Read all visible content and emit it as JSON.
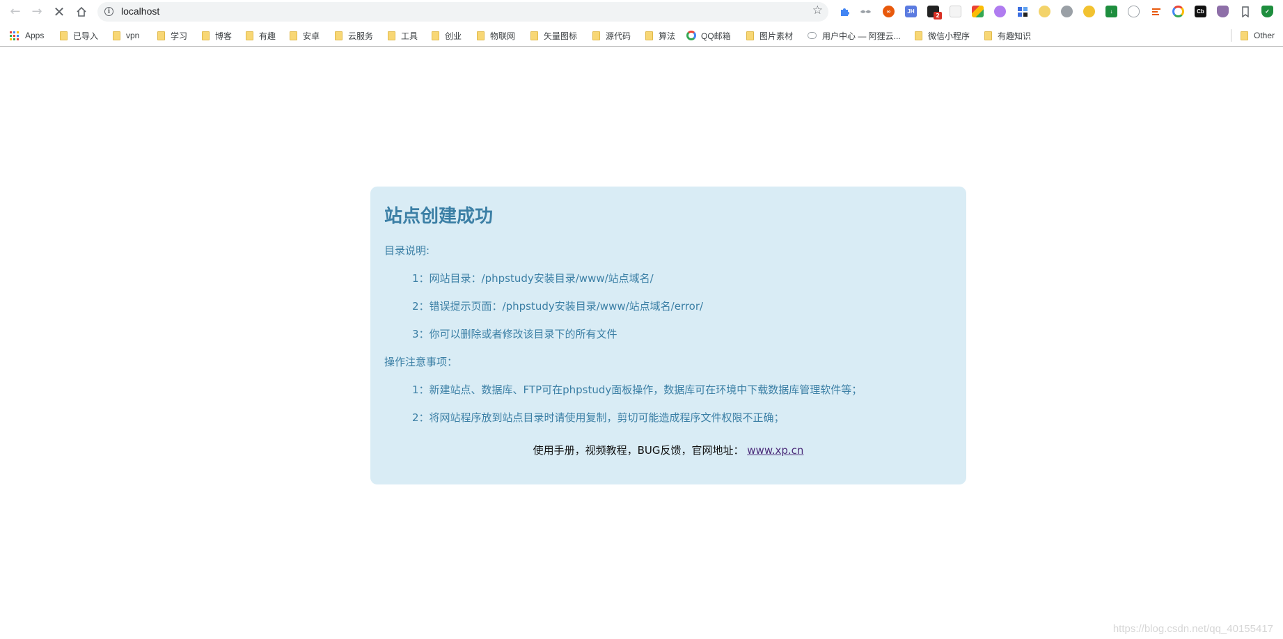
{
  "browser": {
    "url": "localhost",
    "extension_badge_count": "2",
    "extension_labels": {
      "jh": "JH",
      "cb": "Cb"
    },
    "bookmarks": [
      {
        "label": "Apps",
        "icon": "apps-grid-icon"
      },
      {
        "label": "已导入",
        "icon": "folder-icon"
      },
      {
        "label": "vpn",
        "icon": "folder-icon"
      },
      {
        "label": "学习",
        "icon": "folder-icon"
      },
      {
        "label": "博客",
        "icon": "folder-icon"
      },
      {
        "label": "有趣",
        "icon": "folder-icon"
      },
      {
        "label": "安卓",
        "icon": "folder-icon"
      },
      {
        "label": "云服务",
        "icon": "folder-icon"
      },
      {
        "label": "工具",
        "icon": "folder-icon"
      },
      {
        "label": "创业",
        "icon": "folder-icon"
      },
      {
        "label": "物联网",
        "icon": "folder-icon"
      },
      {
        "label": "矢量图标",
        "icon": "folder-icon"
      },
      {
        "label": "源代码",
        "icon": "folder-icon"
      },
      {
        "label": "算法",
        "icon": "folder-icon"
      },
      {
        "label": "QQ邮箱",
        "icon": "qq-mail-icon"
      },
      {
        "label": "图片素材",
        "icon": "folder-icon"
      },
      {
        "label": "用户中心 — 阿狸云...",
        "icon": "cloud-icon"
      },
      {
        "label": "微信小程序",
        "icon": "folder-icon"
      },
      {
        "label": "有趣知识",
        "icon": "folder-icon"
      },
      {
        "label": "Other",
        "icon": "folder-icon"
      }
    ]
  },
  "page": {
    "title": "站点创建成功",
    "section1_heading": "目录说明:",
    "section1_items": [
      "1：网站目录：/phpstudy安装目录/www/站点域名/",
      "2：错误提示页面：/phpstudy安装目录/www/站点域名/error/",
      "3：你可以删除或者修改该目录下的所有文件"
    ],
    "section2_heading": "操作注意事项：",
    "section2_items": [
      "1：新建站点、数据库、FTP可在phpstudy面板操作，数据库可在环境中下载数据库管理软件等；",
      "2：将网站程序放到站点目录时请使用复制，剪切可能造成程序文件权限不正确；"
    ],
    "footer_text": "使用手册，视频教程，BUG反馈，官网地址：",
    "footer_link": "www.xp.cn"
  },
  "watermark": "https://blog.csdn.net/qq_40155417",
  "colors": {
    "card_bg": "#d9ecf5",
    "heading": "#3b7fa5",
    "link": "#4b2c7a"
  }
}
